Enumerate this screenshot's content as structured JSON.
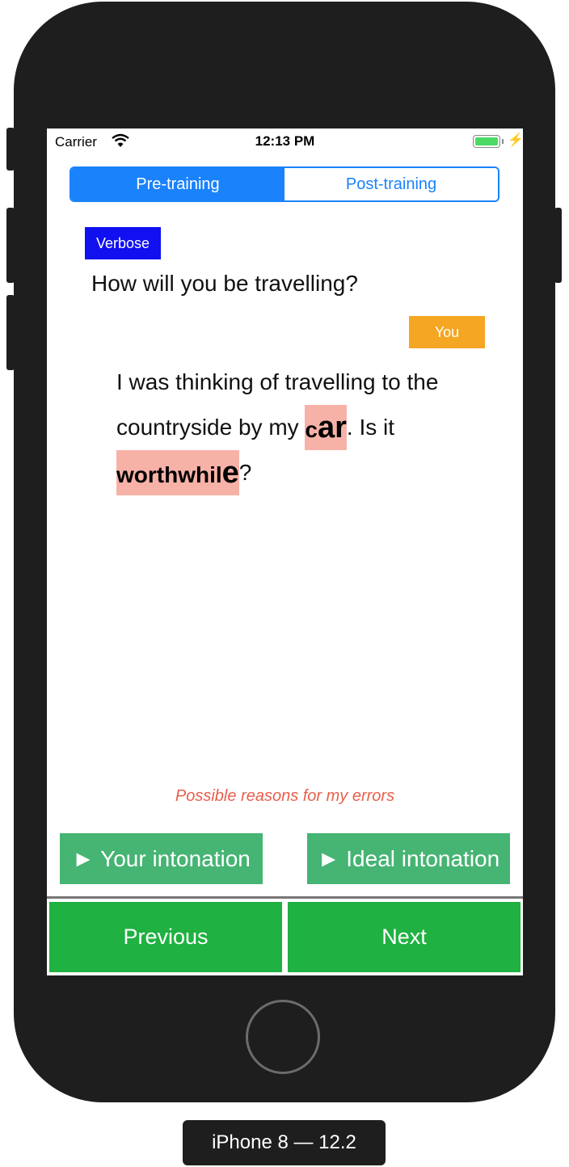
{
  "status_bar": {
    "carrier": "Carrier",
    "time": "12:13 PM"
  },
  "tabs": [
    {
      "label": "Pre-training",
      "selected": true
    },
    {
      "label": "Post-training",
      "selected": false
    }
  ],
  "conversation": {
    "speaker_tag": "Verbose",
    "question": "How will you be travelling?",
    "user_tag": "You",
    "answer_lines": [
      [
        {
          "text": "I was thinking of travelling to the"
        }
      ],
      [
        {
          "text": "countryside by my "
        },
        {
          "text": "c",
          "hl": true
        },
        {
          "text": "ar",
          "hl": true,
          "big": true
        },
        {
          "text": ". Is it"
        }
      ],
      [
        {
          "text": "worthwhil",
          "hl": true
        },
        {
          "text": "e",
          "hl": true,
          "big": true
        },
        {
          "text": "?"
        }
      ]
    ]
  },
  "reasons_link": "Possible reasons for my errors",
  "buttons": {
    "your_intonation": "► Your intonation",
    "ideal_intonation": "► Ideal intonation",
    "previous": "Previous",
    "next": "Next"
  },
  "device_label": "iPhone 8 — 12.2",
  "colors": {
    "accent_blue": "#1a82fb",
    "verbose_tag": "#1010f0",
    "you_tag": "#f5a623",
    "error_highlight": "#f7b2a8",
    "intonation_button": "#46b473",
    "nav_button": "#1fb141",
    "reasons_text": "#e8604c"
  }
}
